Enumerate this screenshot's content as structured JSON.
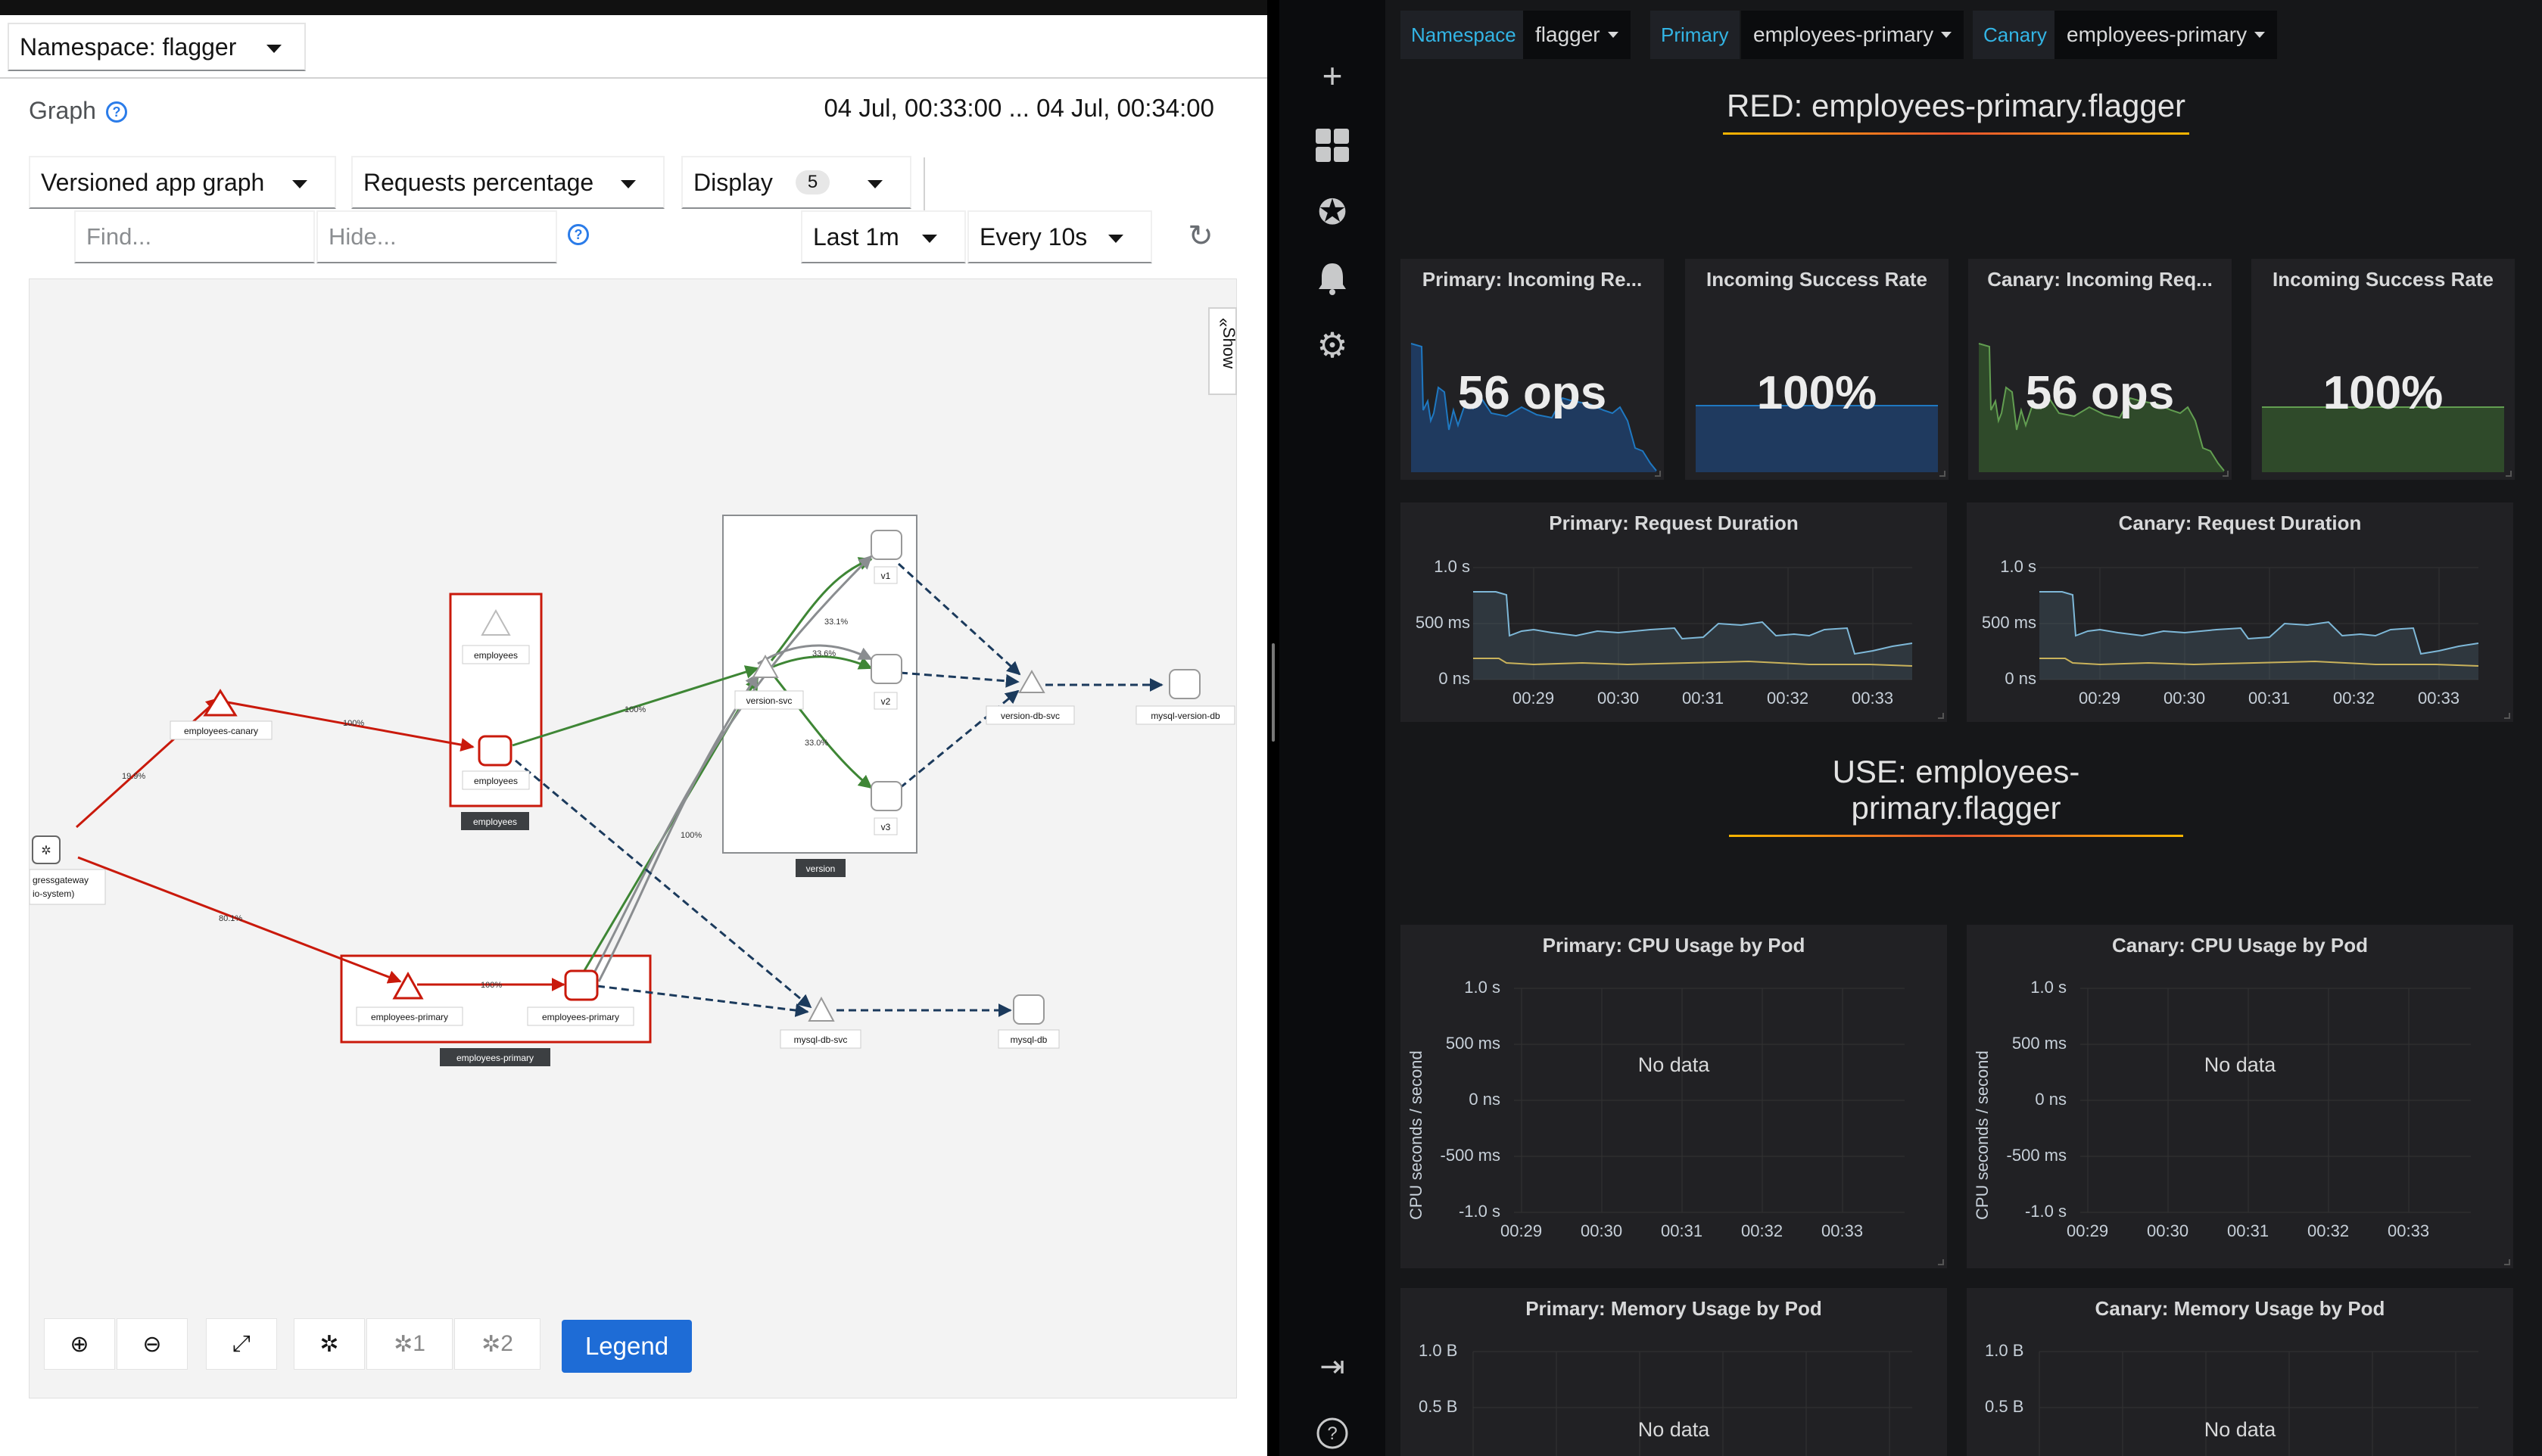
{
  "kiali": {
    "namespace_label": "Namespace: flagger",
    "graph_title": "Graph",
    "time_range": "04 Jul, 00:33:00 ... 04 Jul, 00:34:00",
    "graph_type": "Versioned app graph",
    "edge_label": "Requests percentage",
    "display_label": "Display",
    "display_count": "5",
    "find_placeholder": "Find...",
    "hide_placeholder": "Hide...",
    "duration": "Last 1m",
    "refresh_interval": "Every 10s",
    "show_tab": "Show",
    "legend_button": "Legend",
    "layout1": "1",
    "layout2": "2",
    "graph": {
      "nodes": {
        "gateway_line1": "gressgateway",
        "gateway_line2": "io-system)",
        "employees_canary": "employees-canary",
        "employees_svc": "employees",
        "employees_app": "employees",
        "employees_box": "employees",
        "employees_primary_svc": "employees-primary",
        "employees_primary_app": "employees-primary",
        "employees_primary_box": "employees-primary",
        "version_svc": "version-svc",
        "v1": "v1",
        "v2": "v2",
        "v3": "v3",
        "version_box": "version",
        "version_db_svc": "version-db-svc",
        "mysql_version_db": "mysql-version-db",
        "mysql_db_svc": "mysql-db-svc",
        "mysql_db": "mysql-db"
      },
      "edge_labels": {
        "gw_canary": "19.9%",
        "gw_primary": "80.1%",
        "canary_emp": "100%",
        "emp_version": "100%",
        "primary_app": "100%",
        "primary_version": "100%",
        "vsvc_v1": "33.1%",
        "vsvc_v2": "33.6%",
        "vsvc_v3": "33.0%"
      }
    }
  },
  "grafana": {
    "variables": [
      {
        "label": "Namespace",
        "value": "flagger"
      },
      {
        "label": "Primary",
        "value": "employees-primary"
      },
      {
        "label": "Canary",
        "value": "employees-primary"
      }
    ],
    "red_title": "RED: employees-primary.flagger",
    "use_title": "USE: employees-primary.flagger",
    "stats": [
      {
        "title": "Primary: Incoming Re...",
        "value": "56 ops",
        "color": "#1f78c1"
      },
      {
        "title": "Incoming Success Rate",
        "value": "100%",
        "color": "#1f78c1"
      },
      {
        "title": "Canary: Incoming Req...",
        "value": "56 ops",
        "color": "#629e51"
      },
      {
        "title": "Incoming Success Rate",
        "value": "100%",
        "color": "#629e51"
      }
    ],
    "duration_panels": [
      {
        "title": "Primary: Request Duration"
      },
      {
        "title": "Canary: Request Duration"
      }
    ],
    "duration_axis": {
      "y_ticks": [
        "1.0 s",
        "500 ms",
        "0 ns"
      ],
      "x_ticks": [
        "00:29",
        "00:30",
        "00:31",
        "00:32",
        "00:33"
      ]
    },
    "cpu_panels": [
      {
        "title": "Primary: CPU Usage by Pod",
        "no_data": "No data"
      },
      {
        "title": "Canary: CPU Usage by Pod",
        "no_data": "No data"
      }
    ],
    "cpu_axis": {
      "ylabel": "CPU seconds / second",
      "y_ticks": [
        "1.0 s",
        "500 ms",
        "0 ns",
        "-500 ms",
        "-1.0 s"
      ],
      "x_ticks": [
        "00:29",
        "00:30",
        "00:31",
        "00:32",
        "00:33"
      ]
    },
    "mem_panels": [
      {
        "title": "Primary: Memory Usage by Pod",
        "no_data": "No data"
      },
      {
        "title": "Canary: Memory Usage by Pod",
        "no_data": "No data"
      }
    ],
    "mem_axis": {
      "y_ticks": [
        "1.0 B",
        "0.5 B"
      ]
    },
    "colors": {
      "accent": "#33b5e5",
      "series_blue": "#7eb8d8",
      "series_yellow": "#c9b25b"
    }
  }
}
